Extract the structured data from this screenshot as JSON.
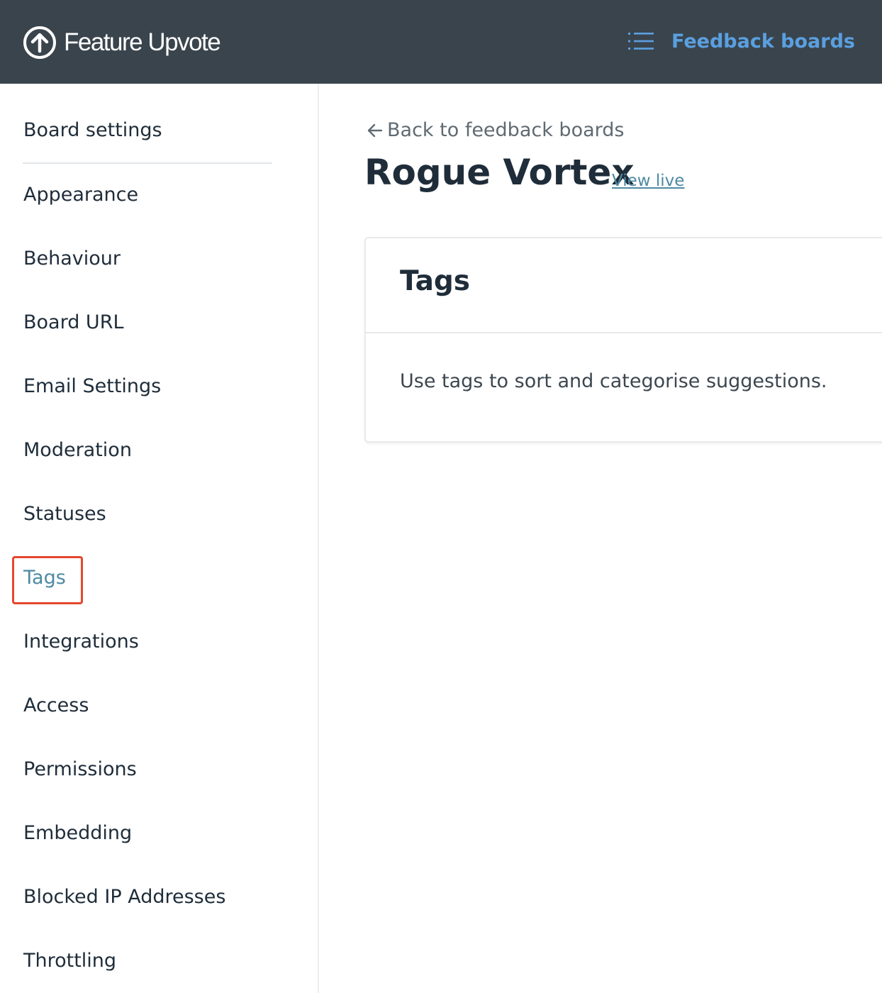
{
  "header": {
    "logo_text": "Feature Upvote",
    "logo_icon": "upvote-circle-arrow-icon",
    "feedback_boards_label": "Feedback boards",
    "feedback_boards_icon": "list-icon",
    "background_color": "#3a444d",
    "link_color": "#5aa0e0"
  },
  "sidebar": {
    "title": "Board settings",
    "active_item": "Tags",
    "items": [
      {
        "label": "Appearance"
      },
      {
        "label": "Behaviour"
      },
      {
        "label": "Board URL"
      },
      {
        "label": "Email Settings"
      },
      {
        "label": "Moderation"
      },
      {
        "label": "Statuses"
      },
      {
        "label": "Tags"
      },
      {
        "label": "Integrations"
      },
      {
        "label": "Access"
      },
      {
        "label": "Permissions"
      },
      {
        "label": "Embedding"
      },
      {
        "label": "Blocked IP Addresses"
      },
      {
        "label": "Throttling"
      }
    ],
    "active_color": "#4d8aa3",
    "highlight_border_color": "#e5482d"
  },
  "main": {
    "back_link_label": "Back to feedback boards",
    "back_icon": "arrow-left-icon",
    "board_name": "Rogue Vortex",
    "view_live_label": "View live",
    "card": {
      "title": "Tags",
      "description": "Use tags to sort and categorise suggestions."
    }
  }
}
